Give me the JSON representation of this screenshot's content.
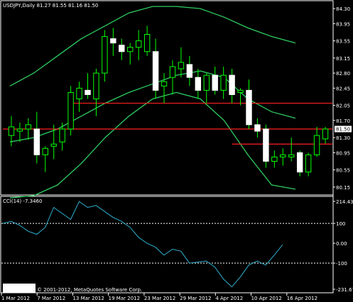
{
  "header": {
    "symbol_info": "USDJPY,Daily  81.27 81.55 81.16 81.50"
  },
  "indicator": {
    "label": "CCI(14) -7.3460"
  },
  "copyright": "© 2001-2012, MetaQuotes Software Corp.",
  "colors": {
    "background": "#000000",
    "grid": "#ffffff",
    "candle_up": "#00ff00",
    "candle_body_up": "#000000",
    "candle_body_down": "#ffffff",
    "bollinger": "#2ecc5f",
    "support_resistance": "#ff2020",
    "cci_line": "#30b0d0",
    "price_marker": "#ffffff"
  },
  "chart_data": [
    {
      "type": "candlestick",
      "title": "USDJPY,Daily",
      "ylim": [
        80.0,
        84.45
      ],
      "y_ticks": [
        "84.30",
        "83.95",
        "83.55",
        "83.15",
        "82.80",
        "82.45",
        "82.05",
        "81.70",
        "81.30",
        "80.95",
        "80.55",
        "80.15"
      ],
      "x_ticks": [
        "1 Mar 2012",
        "7 Mar 2012",
        "13 Mar 2012",
        "19 Mar 2012",
        "23 Mar 2012",
        "29 Mar 2012",
        "4 Apr 2012",
        "10 Apr 2012",
        "16 Apr 2012"
      ],
      "current_price": "81.50",
      "horizontal_lines": [
        82.1,
        81.5,
        81.15
      ],
      "candles": [
        {
          "o": 81.35,
          "h": 81.8,
          "l": 81.1,
          "c": 81.55
        },
        {
          "o": 81.45,
          "h": 81.65,
          "l": 81.2,
          "c": 81.5
        },
        {
          "o": 81.5,
          "h": 81.75,
          "l": 81.25,
          "c": 81.6
        },
        {
          "o": 81.5,
          "h": 81.9,
          "l": 80.7,
          "c": 80.9
        },
        {
          "o": 80.9,
          "h": 81.1,
          "l": 80.5,
          "c": 81.05
        },
        {
          "o": 81.1,
          "h": 81.6,
          "l": 80.8,
          "c": 81.15
        },
        {
          "o": 81.2,
          "h": 81.65,
          "l": 81.0,
          "c": 81.5
        },
        {
          "o": 81.5,
          "h": 82.5,
          "l": 81.35,
          "c": 82.35
        },
        {
          "o": 82.2,
          "h": 82.6,
          "l": 81.9,
          "c": 82.45
        },
        {
          "o": 82.4,
          "h": 82.8,
          "l": 82.2,
          "c": 82.3
        },
        {
          "o": 82.2,
          "h": 82.9,
          "l": 81.8,
          "c": 82.8
        },
        {
          "o": 82.8,
          "h": 83.8,
          "l": 82.6,
          "c": 83.65
        },
        {
          "o": 83.6,
          "h": 83.85,
          "l": 83.2,
          "c": 83.5
        },
        {
          "o": 83.45,
          "h": 83.6,
          "l": 83.1,
          "c": 83.3
        },
        {
          "o": 83.3,
          "h": 83.5,
          "l": 83.0,
          "c": 83.4
        },
        {
          "o": 83.4,
          "h": 83.8,
          "l": 83.1,
          "c": 83.55
        },
        {
          "o": 83.3,
          "h": 83.9,
          "l": 83.2,
          "c": 83.7
        },
        {
          "o": 83.3,
          "h": 83.6,
          "l": 82.2,
          "c": 82.4
        },
        {
          "o": 82.5,
          "h": 82.8,
          "l": 82.1,
          "c": 82.6
        },
        {
          "o": 82.7,
          "h": 83.1,
          "l": 82.3,
          "c": 82.95
        },
        {
          "o": 82.9,
          "h": 83.4,
          "l": 82.7,
          "c": 83.05
        },
        {
          "o": 83.0,
          "h": 83.2,
          "l": 82.5,
          "c": 82.7
        },
        {
          "o": 82.7,
          "h": 82.9,
          "l": 82.2,
          "c": 82.4
        },
        {
          "o": 82.4,
          "h": 82.8,
          "l": 82.1,
          "c": 82.75
        },
        {
          "o": 82.75,
          "h": 82.95,
          "l": 82.3,
          "c": 82.4
        },
        {
          "o": 82.4,
          "h": 82.95,
          "l": 82.2,
          "c": 82.75
        },
        {
          "o": 82.75,
          "h": 82.9,
          "l": 82.1,
          "c": 82.3
        },
        {
          "o": 82.35,
          "h": 82.45,
          "l": 82.05,
          "c": 82.4
        },
        {
          "o": 82.4,
          "h": 82.65,
          "l": 81.5,
          "c": 81.6
        },
        {
          "o": 81.6,
          "h": 81.75,
          "l": 81.3,
          "c": 81.45
        },
        {
          "o": 81.5,
          "h": 81.6,
          "l": 80.6,
          "c": 80.75
        },
        {
          "o": 80.75,
          "h": 81.0,
          "l": 80.6,
          "c": 80.85
        },
        {
          "o": 80.85,
          "h": 81.05,
          "l": 80.65,
          "c": 80.9
        },
        {
          "o": 80.85,
          "h": 81.3,
          "l": 80.75,
          "c": 80.9
        },
        {
          "o": 80.95,
          "h": 81.0,
          "l": 80.4,
          "c": 80.5
        },
        {
          "o": 80.5,
          "h": 80.95,
          "l": 80.4,
          "c": 80.9
        },
        {
          "o": 80.9,
          "h": 81.55,
          "l": 80.85,
          "c": 81.35
        },
        {
          "o": 81.27,
          "h": 81.55,
          "l": 81.16,
          "c": 81.5
        }
      ],
      "bollinger": {
        "upper": [
          82.5,
          82.8,
          83.2,
          83.6,
          83.9,
          84.2,
          84.35,
          84.35,
          84.3,
          84.1,
          83.85,
          83.65,
          83.5
        ],
        "middle": [
          81.2,
          81.3,
          81.5,
          81.8,
          82.1,
          82.35,
          82.55,
          82.75,
          82.85,
          82.7,
          82.2,
          81.9,
          81.75
        ],
        "lower": [
          79.9,
          79.95,
          80.2,
          80.7,
          81.3,
          81.8,
          82.2,
          82.35,
          82.2,
          81.7,
          80.9,
          80.2,
          80.1
        ]
      }
    },
    {
      "type": "line",
      "title": "CCI(14) -7.3460",
      "ylim": [
        -231.674,
        214.4393
      ],
      "y_ticks": [
        "214.4393",
        "100",
        "0.00",
        "-100",
        "-231.674"
      ],
      "values": [
        100,
        110,
        90,
        60,
        45,
        80,
        180,
        150,
        120,
        210,
        180,
        190,
        160,
        130,
        110,
        80,
        30,
        0,
        -20,
        -60,
        -30,
        -40,
        -100,
        -95,
        -90,
        -120,
        -180,
        -220,
        -170,
        -110,
        -90,
        -110,
        -60,
        -7
      ]
    }
  ]
}
